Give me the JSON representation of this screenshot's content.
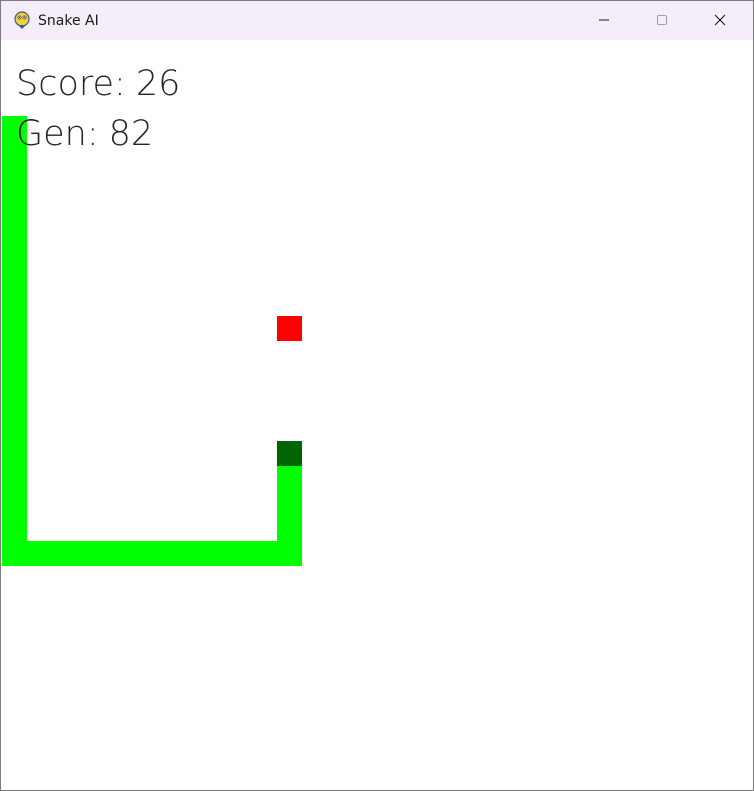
{
  "window": {
    "title": "Snake AI",
    "icon": "pygame-snake-icon",
    "controls": [
      "minimize-icon",
      "maximize-icon",
      "close-icon"
    ]
  },
  "hud": {
    "score_label": "Score:",
    "score_value": "26",
    "gen_label": "Gen:",
    "gen_value": "82"
  },
  "colors": {
    "snake_body": "#00ff00",
    "snake_head": "#006400",
    "food": "#ff0000",
    "background": "#ffffff"
  }
}
